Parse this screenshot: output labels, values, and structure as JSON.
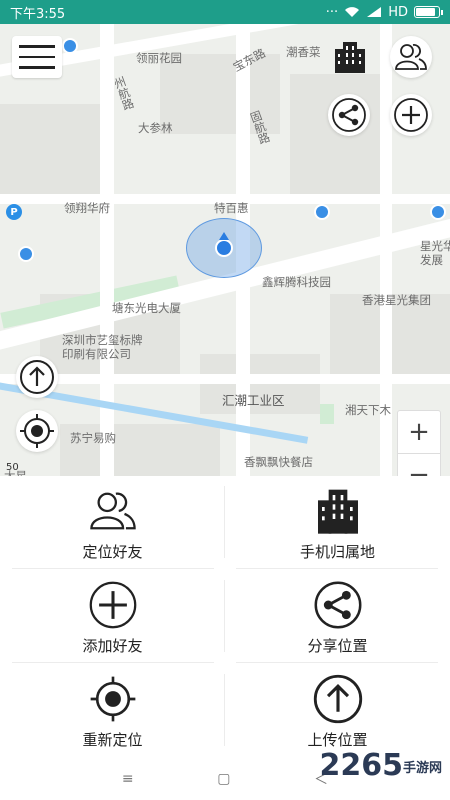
{
  "status_bar": {
    "time": "下午3:55",
    "network": "HD"
  },
  "map": {
    "labels": [
      "领丽花园",
      "宝东路",
      "潮香菜",
      "州航路",
      "大参林",
      "固航路",
      "领翔华府",
      "特百惠",
      "鑫辉腾科技园",
      "星光华",
      "发展",
      "塘东光电大厦",
      "深圳市艺玺标牌",
      "印刷有限公司",
      "香港星光集团",
      "汇潮工业区",
      "湘天下木",
      "苏宁易购",
      "香飘飘快餐店",
      "太星"
    ],
    "scale_text": "50",
    "zoom_in": "+",
    "zoom_out": "−"
  },
  "grid": {
    "items": [
      {
        "label": "定位好友",
        "icon": "users-icon"
      },
      {
        "label": "手机归属地",
        "icon": "building-icon"
      },
      {
        "label": "添加好友",
        "icon": "add-circle-icon"
      },
      {
        "label": "分享位置",
        "icon": "share-circle-icon"
      },
      {
        "label": "重新定位",
        "icon": "locate-icon"
      },
      {
        "label": "上传位置",
        "icon": "upload-circle-icon"
      }
    ]
  },
  "nav": {
    "menu": "≡",
    "home": "▢",
    "back": "＜"
  },
  "watermark": {
    "brand": "2265",
    "suffix": "手游网"
  },
  "colors": {
    "status_bar": "#1e9e8a",
    "location": "#2a7de1",
    "map_bg": "#eef0ec"
  }
}
